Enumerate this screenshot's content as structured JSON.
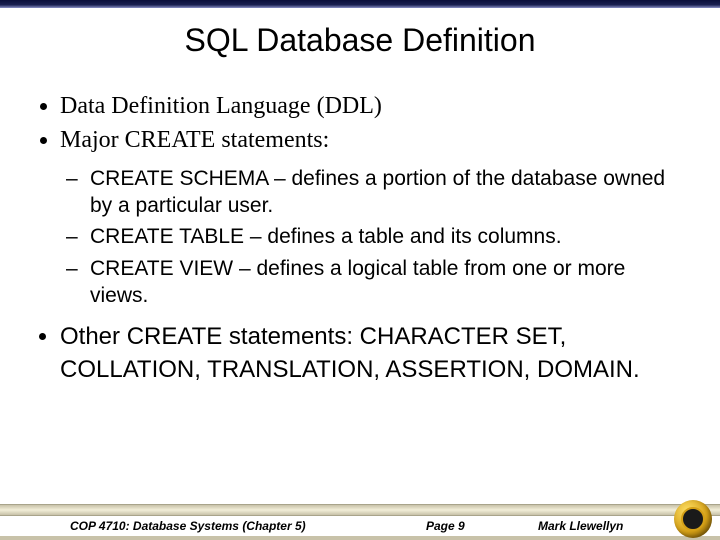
{
  "title": "SQL Database Definition",
  "bullets": {
    "b1": "Data Definition Language (DDL)",
    "b2": "Major CREATE statements:",
    "sub1": "CREATE SCHEMA – defines a portion of the database owned by a particular user.",
    "sub2": "CREATE TABLE – defines a table and its columns.",
    "sub3": "CREATE VIEW – defines a logical table from one or more views.",
    "b3": "Other CREATE statements: CHARACTER SET, COLLATION, TRANSLATION, ASSERTION, DOMAIN."
  },
  "footer": {
    "course": "COP 4710: Database Systems  (Chapter 5)",
    "page": "Page 9",
    "author": "Mark Llewellyn"
  }
}
